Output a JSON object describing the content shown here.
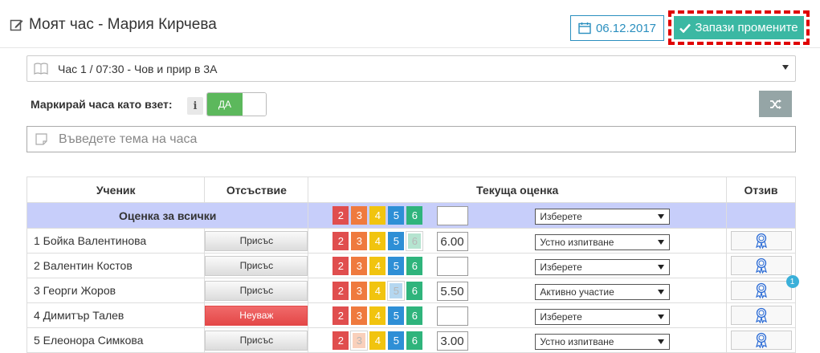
{
  "header": {
    "title": "Моят час - Мария Кирчева",
    "date": "06.12.2017",
    "save_label": "Запази промените"
  },
  "lesson": {
    "selected": "Час 1 / 07:30 - Чов и прир в 3А"
  },
  "mark": {
    "label": "Маркирай часа като взет:",
    "info": "i",
    "toggle": "ДА"
  },
  "topic": {
    "placeholder": "Въведете тема на часа"
  },
  "table": {
    "headers": [
      "Ученик",
      "Отсъствие",
      "Текуща оценка",
      "Отзив"
    ],
    "all_label": "Оценка за всички",
    "grade_options": [
      "2",
      "3",
      "4",
      "5",
      "6"
    ],
    "all_type": "Изберете",
    "rows": [
      {
        "name": "1 Бойка Валентинова",
        "absence": "Присъс",
        "value": "6.00",
        "type": "Устно изпитване"
      },
      {
        "name": "2 Валентин Костов",
        "absence": "Присъс",
        "value": "",
        "type": "Изберете"
      },
      {
        "name": "3 Георги Жоров",
        "absence": "Присъс",
        "value": "5.50",
        "type": "Активно участие",
        "badge": "1"
      },
      {
        "name": "4 Димитър Талев",
        "absence": "Неуваж",
        "value": "",
        "type": "Изберете"
      },
      {
        "name": "5 Елеонора Симкова",
        "absence": "Присъс",
        "value": "3.00",
        "type": "Устно изпитване"
      }
    ]
  }
}
